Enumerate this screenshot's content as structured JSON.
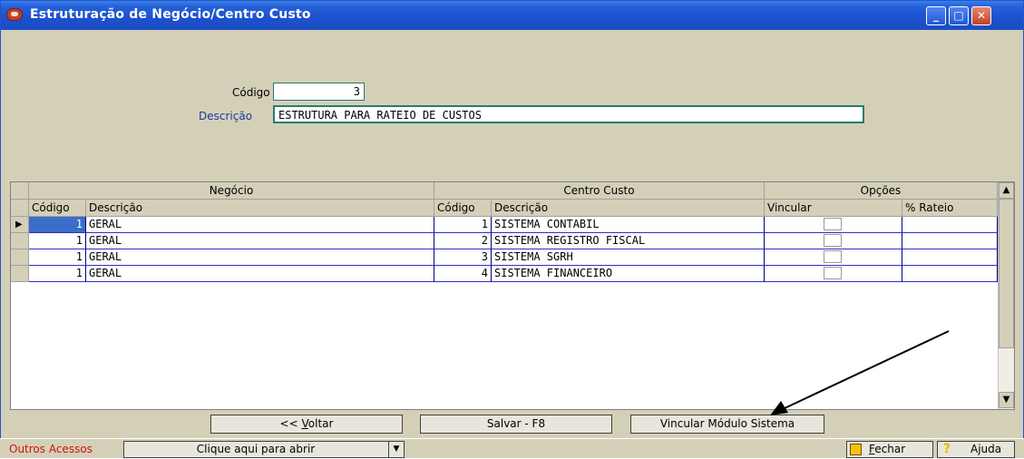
{
  "window": {
    "title": "Estruturação de Negócio/Centro Custo",
    "buttons": {
      "minimize": "_",
      "maximize": "□",
      "close": "✕"
    }
  },
  "form": {
    "codigo_label": "Código",
    "codigo_value": "3",
    "descricao_label": "Descrição",
    "descricao_value": "ESTRUTURA PARA RATEIO DE CUSTOS"
  },
  "grid": {
    "groups": {
      "negocio": "Negócio",
      "centro": "Centro Custo",
      "opcoes": "Opções"
    },
    "columns": {
      "neg_codigo": "Código",
      "neg_descricao": "Descrição",
      "cc_codigo": "Código",
      "cc_descricao": "Descrição",
      "vincular": "Vincular",
      "rateio": "% Rateio"
    },
    "current_row_marker": "▶",
    "rows": [
      {
        "neg_codigo": "1",
        "neg_descricao": "GERAL",
        "cc_codigo": "1",
        "cc_descricao": "SISTEMA CONTABIL",
        "vincular": false,
        "rateio": ""
      },
      {
        "neg_codigo": "1",
        "neg_descricao": "GERAL",
        "cc_codigo": "2",
        "cc_descricao": "SISTEMA REGISTRO FISCAL",
        "vincular": false,
        "rateio": ""
      },
      {
        "neg_codigo": "1",
        "neg_descricao": "GERAL",
        "cc_codigo": "3",
        "cc_descricao": "SISTEMA SGRH",
        "vincular": false,
        "rateio": ""
      },
      {
        "neg_codigo": "1",
        "neg_descricao": "GERAL",
        "cc_codigo": "4",
        "cc_descricao": "SISTEMA FINANCEIRO",
        "vincular": false,
        "rateio": ""
      }
    ]
  },
  "actions": {
    "voltar_prefix": "<< ",
    "voltar_mnemonic": "V",
    "voltar_rest": "oltar",
    "salvar": "Salvar - F8",
    "vincular": "Vincular Módulo Sistema"
  },
  "statusbar": {
    "outros_label": "Outros Acessos",
    "combo_value": "Clique aqui para abrir",
    "fechar_mnemonic": "F",
    "fechar_rest": "echar",
    "ajuda": "Ajuda"
  },
  "colors": {
    "titlebar": "#2461d9",
    "window_bg": "#d4d0b8",
    "selected_cell": "#3a6ec8",
    "outros_label": "#d01010"
  }
}
